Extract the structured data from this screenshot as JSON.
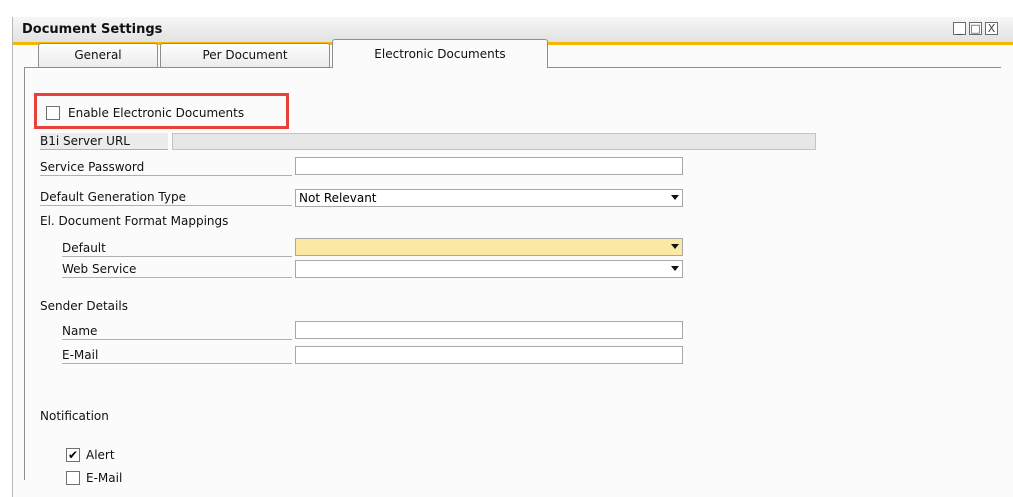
{
  "window": {
    "title": "Document Settings",
    "minimize_label": "_",
    "restore_label": "□",
    "close_label": "X"
  },
  "tabs": [
    {
      "label": "General",
      "active": false
    },
    {
      "label": "Per Document",
      "active": false
    },
    {
      "label": "Electronic Documents",
      "active": true
    }
  ],
  "form": {
    "enable_checkbox": {
      "label": "Enable Electronic Documents",
      "checked": false
    },
    "b1i_server_url": {
      "label": "B1i Server URL",
      "value": ""
    },
    "service_password": {
      "label": "Service Password",
      "value": ""
    },
    "default_generation_type": {
      "label": "Default Generation Type",
      "value": "Not Relevant"
    },
    "format_mappings": {
      "label": "El. Document Format Mappings",
      "default": {
        "label": "Default",
        "value": ""
      },
      "web_service": {
        "label": "Web Service",
        "value": ""
      }
    },
    "sender_details": {
      "label": "Sender Details",
      "name": {
        "label": "Name",
        "value": ""
      },
      "email": {
        "label": "E-Mail",
        "value": ""
      }
    },
    "notification": {
      "label": "Notification",
      "alert": {
        "label": "Alert",
        "checked": true,
        "mark": "✔"
      },
      "email": {
        "label": "E-Mail",
        "checked": false
      }
    }
  },
  "colors": {
    "title_accent": "#f4b600",
    "highlight_box": "#e8413c",
    "active_field": "#fbe9a3"
  }
}
